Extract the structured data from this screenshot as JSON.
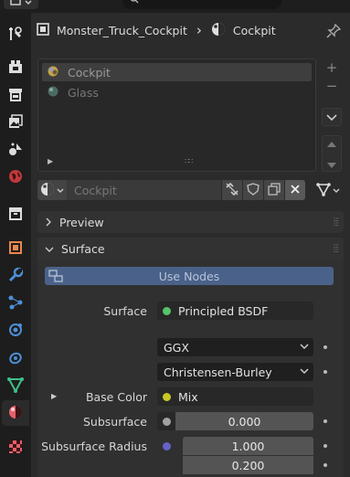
{
  "breadcrumb": {
    "object_name": "Monster_Truck_Cockpit",
    "separator": "›",
    "material_name": "Cockpit"
  },
  "material_slots": [
    {
      "name": "Cockpit",
      "selected": true
    },
    {
      "name": "Glass",
      "selected": false
    }
  ],
  "slot_buttons": {
    "add": "+",
    "remove": "−"
  },
  "material_field": {
    "value": "Cockpit"
  },
  "panels": {
    "preview": "Preview",
    "surface": "Surface"
  },
  "surface": {
    "use_nodes": "Use Nodes",
    "surface_label": "Surface",
    "surface_shader": "Principled BSDF",
    "distribution": "GGX",
    "subsurface_method": "Christensen-Burley",
    "base_color_label": "Base Color",
    "base_color_value": "Mix",
    "subsurface_label": "Subsurface",
    "subsurface_value": "0.000",
    "subsurface_radius_label": "Subsurface Radius",
    "subsurface_radius_values": [
      "1.000",
      "0.200"
    ]
  },
  "colors": {
    "accent": "#4a6289",
    "shader_socket": "#55c46a",
    "color_socket": "#c7c729",
    "float_socket": "#a1a1a1",
    "vector_socket": "#6464c7"
  }
}
